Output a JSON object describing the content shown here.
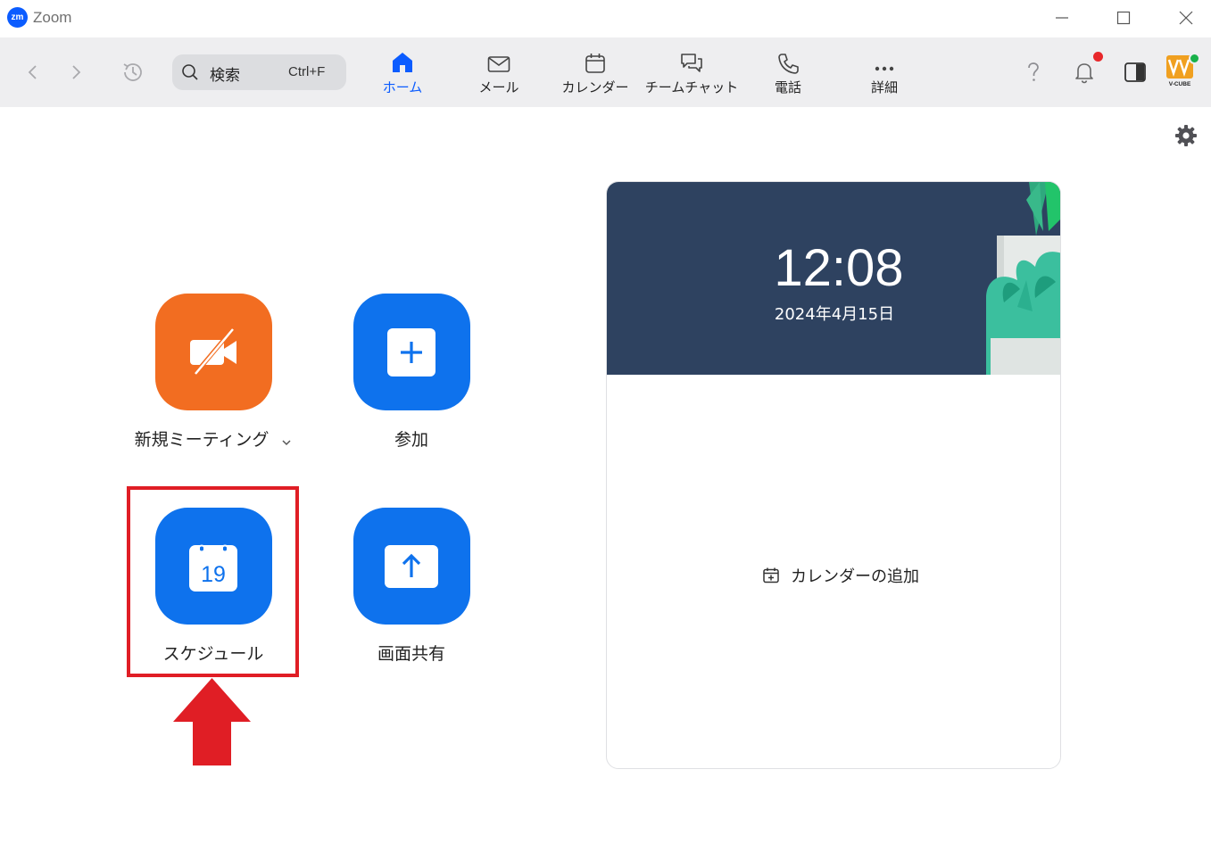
{
  "window": {
    "title": "Zoom",
    "logo_text": "zm"
  },
  "toolbar": {
    "search": {
      "label": "検索",
      "shortcut": "Ctrl+F"
    },
    "tabs": [
      {
        "label": "ホーム",
        "icon": "home-icon",
        "active": true
      },
      {
        "label": "メール",
        "icon": "mail-icon",
        "active": false
      },
      {
        "label": "カレンダー",
        "icon": "calendar-icon",
        "active": false
      },
      {
        "label": "チームチャット",
        "icon": "chat-icon",
        "active": false
      },
      {
        "label": "電話",
        "icon": "phone-icon",
        "active": false
      },
      {
        "label": "詳細",
        "icon": "more-icon",
        "active": false
      }
    ],
    "help_icon": "help-icon",
    "notification_icon": "bell-icon",
    "side_panel_icon": "side-panel-icon",
    "avatar_text": "V-CUBE"
  },
  "main": {
    "actions": [
      {
        "label": "新規ミーティング",
        "icon": "video-off-icon",
        "color": "#f26d21",
        "has_dropdown": true
      },
      {
        "label": "参加",
        "icon": "plus-icon",
        "color": "#0e72ed"
      },
      {
        "label": "スケジュール",
        "icon": "calendar-19-icon",
        "color": "#0e72ed",
        "calendar_day": "19",
        "highlighted": true
      },
      {
        "label": "画面共有",
        "icon": "share-up-icon",
        "color": "#0e72ed"
      }
    ]
  },
  "calendar_card": {
    "time": "12:08",
    "date": "2024年4月15日",
    "add_calendar_label": "カレンダーの追加"
  },
  "colors": {
    "accent": "#0b5cff",
    "highlight": "#e01e25",
    "header_bg": "#2e4260"
  }
}
